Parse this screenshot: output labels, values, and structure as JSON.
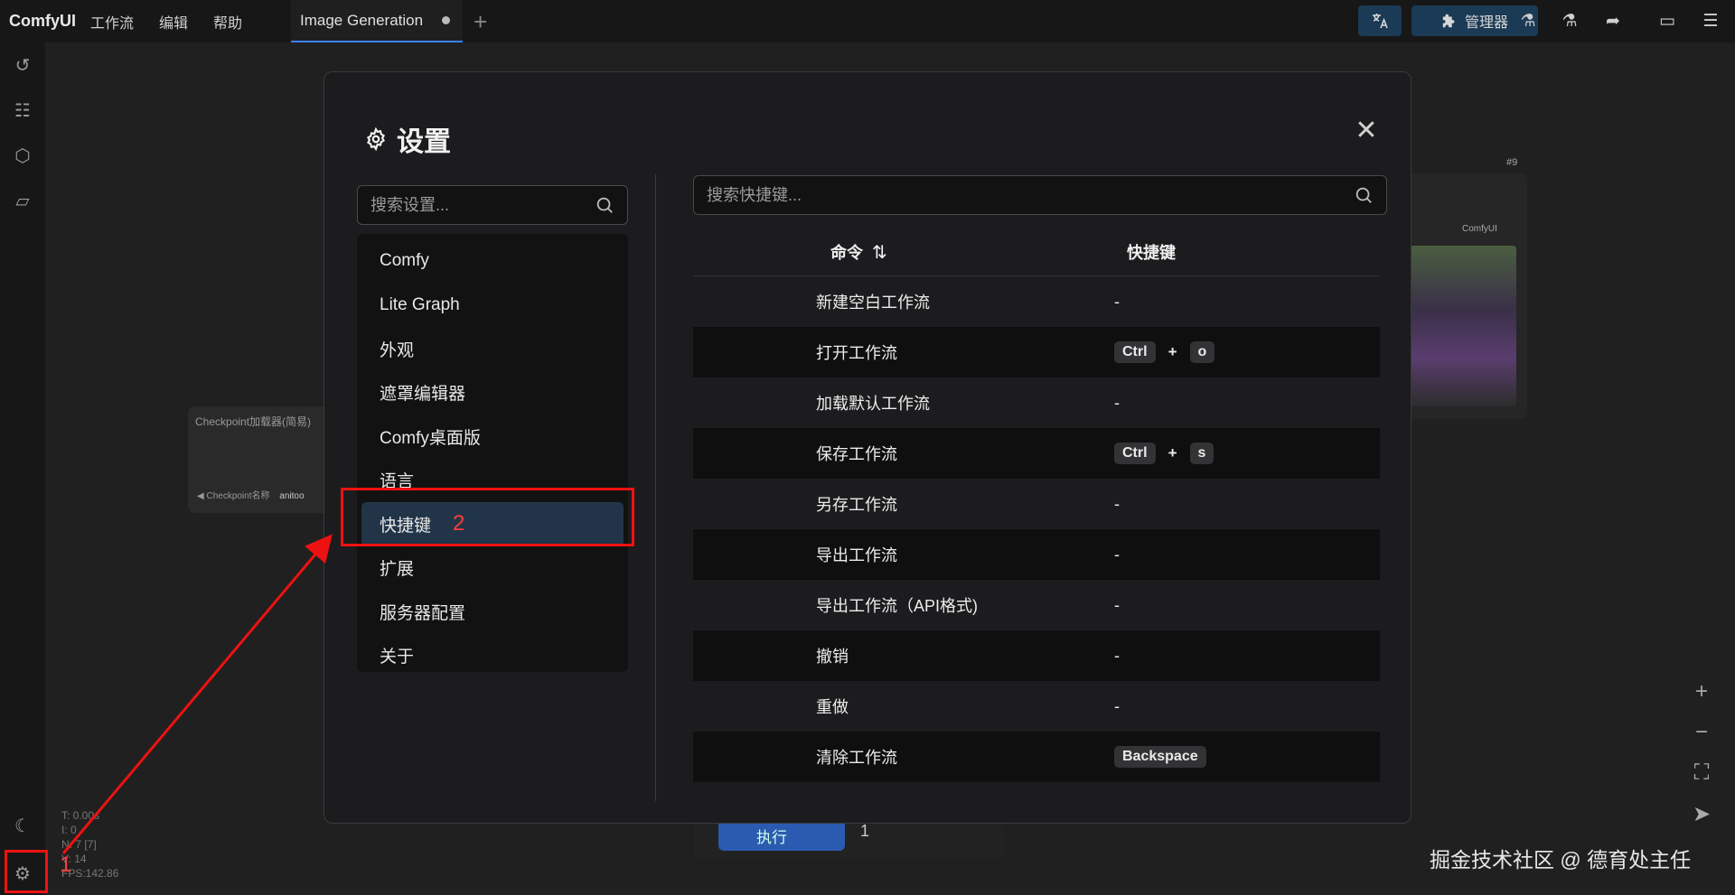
{
  "app": {
    "name": "ComfyUI",
    "menu": [
      "工作流",
      "编辑",
      "帮助"
    ],
    "tab_title": "Image Generation",
    "manager_label": "管理器"
  },
  "canvas": {
    "node_title": "Checkpoint加载器(简易)",
    "node_field_label": "◀ Checkpoint名称",
    "node_field_value": "anitoo",
    "node2_tag": "#9",
    "node2_badge": "ComfyUI",
    "run_label": "执行",
    "run_count": "1",
    "stats": [
      "T: 0.00s",
      "I: 0",
      "N: 7 [7]",
      "V: 14",
      "FPS:142.86"
    ]
  },
  "settings": {
    "title": "设置",
    "search_placeholder": "搜索设置...",
    "categories": [
      "Comfy",
      "Lite Graph",
      "外观",
      "遮罩编辑器",
      "Comfy桌面版",
      "语言",
      "快捷键",
      "扩展",
      "服务器配置",
      "关于"
    ],
    "active_category": "快捷键",
    "keybinding_search_placeholder": "搜索快捷键...",
    "table": {
      "col_command": "命令",
      "col_keybinding": "快捷键",
      "rows": [
        {
          "command": "新建空白工作流",
          "keys": []
        },
        {
          "command": "打开工作流",
          "keys": [
            "Ctrl",
            "o"
          ]
        },
        {
          "command": "加载默认工作流",
          "keys": []
        },
        {
          "command": "保存工作流",
          "keys": [
            "Ctrl",
            "s"
          ]
        },
        {
          "command": "另存工作流",
          "keys": []
        },
        {
          "command": "导出工作流",
          "keys": []
        },
        {
          "command": "导出工作流（API格式)",
          "keys": []
        },
        {
          "command": "撤销",
          "keys": []
        },
        {
          "command": "重做",
          "keys": []
        },
        {
          "command": "清除工作流",
          "keys": [
            "Backspace"
          ]
        }
      ],
      "empty_key": "-",
      "plus": "+"
    }
  },
  "annotations": {
    "marker_1": "1",
    "marker_2": "2",
    "color": "#e11111"
  },
  "watermark": "掘金技术社区 @ 德育处主任",
  "colors": {
    "accent": "#3b82f6",
    "active_category_bg": "#223548",
    "header_button_bg": "#1b3a55"
  }
}
